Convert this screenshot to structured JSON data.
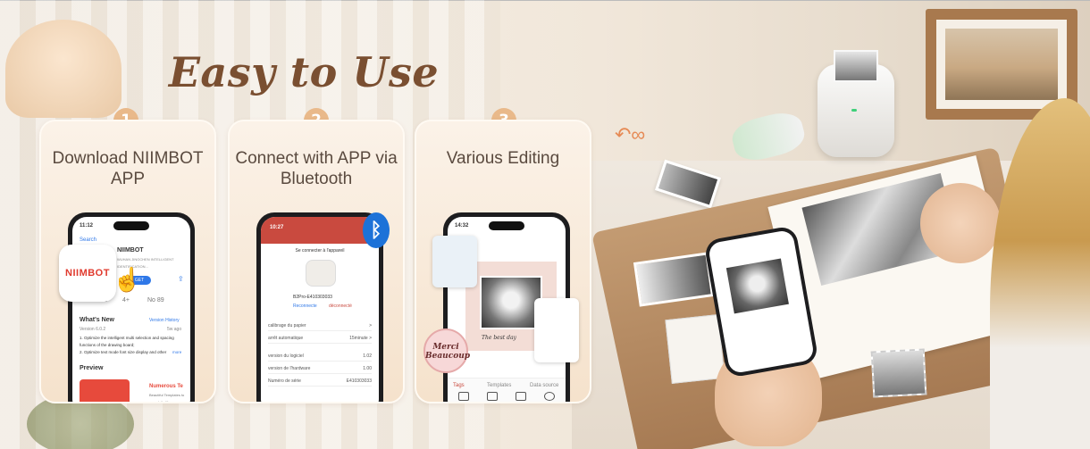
{
  "headline": "Easy to Use",
  "steps": [
    {
      "number": "1",
      "title": "Download NIIMBOT APP"
    },
    {
      "number": "2",
      "title": "Connect with APP via Bluetooth"
    },
    {
      "number": "3",
      "title": "Various Editing"
    }
  ],
  "phone1": {
    "time": "11:12",
    "back": "Search",
    "app_name": "NIIMBOT",
    "developer": "WUHAN JINGCHEN INTELLIGENT IDENTIFICATION...",
    "logo_text": "NIIMBOT",
    "get": "GET",
    "rating": "4.9",
    "age": "4+",
    "chart": "No 89",
    "whats_new": "What's New",
    "version_history": "Version History",
    "version": "Version 6.0.2",
    "ago": "5w ago",
    "notes1": "1. Optimize the intelligent multi selection and spacing functions of the drawing board;",
    "notes2": "2. Optimize text mode font size display and other",
    "more": "more",
    "preview": "Preview",
    "promo": "Numerous Te",
    "promo_sub": "Beautiful Templates to your daily life"
  },
  "phone2": {
    "time": "10:27",
    "header": "Se connecter à l'appareil",
    "device_id": "B2Pro-E410303033",
    "reconnect": "Reconnecte",
    "disconnect": "déconnecté",
    "rows": [
      {
        "label": "calibrage du papier",
        "value": ">"
      },
      {
        "label": "arrêt automatique",
        "value": "15minute >"
      },
      {
        "label": "version du logiciel",
        "value": "1.02"
      },
      {
        "label": "version de l'hardware",
        "value": "1.00"
      },
      {
        "label": "Numéro de série",
        "value": "E410303033"
      }
    ],
    "bluetooth_icon": "bluetooth-icon"
  },
  "phone3": {
    "time": "14:32",
    "caption": "The best day",
    "merci": "Merci Beaucoup",
    "tabs": [
      "Tags",
      "Templates",
      "Data source"
    ]
  }
}
